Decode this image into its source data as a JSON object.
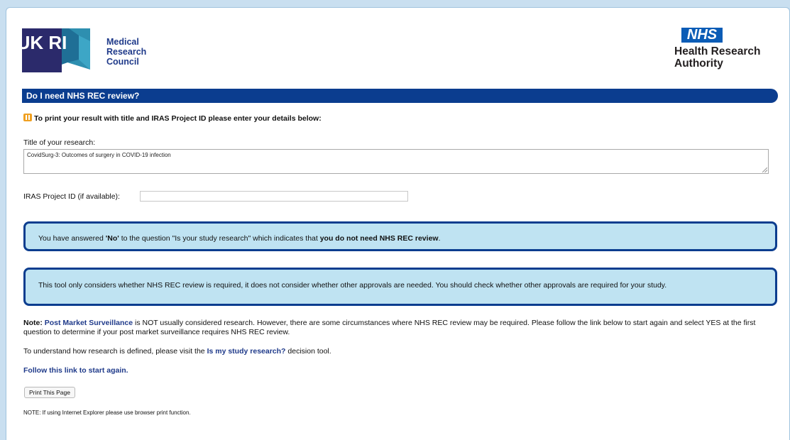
{
  "header": {
    "ukri_logo_text": "UK RI",
    "funder_lines": [
      "Medical",
      "Research",
      "Council"
    ],
    "nhs_logo_text": "NHS",
    "hra_lines": [
      "Health Research",
      "Authority"
    ]
  },
  "page_title": "Do I need NHS REC review?",
  "info_prompt": "To print your result with title and IRAS Project ID please enter your details below:",
  "form": {
    "title_label": "Title of your research:",
    "title_value": "CovidSurg-3: Outcomes of surgery in COVID-19 infection",
    "iras_label": "IRAS Project ID (if available):",
    "iras_value": ""
  },
  "result": {
    "prefix": "You have answered ",
    "answer": "'No'",
    "middle": " to the question \"Is your study research\" which indicates that ",
    "conclusion": "you do not need NHS REC review",
    "suffix": "."
  },
  "disclaimer": "This tool only considers whether NHS REC review is required, it does not consider whether other approvals are needed. You should check whether other approvals are required for your study.",
  "note": {
    "label": "Note:",
    "link": "Post Market Surveillance",
    "text": " is NOT usually considered research. However, there are some circumstances where NHS REC review may be required. Please follow the link below to start again and select YES at the first question to determine if your post market surveillance requires NHS REC review."
  },
  "define": {
    "prefix": "To understand how research is defined, please visit the ",
    "link": "Is my study research?",
    "suffix": " decision tool."
  },
  "restart_link": "Follow this link to start again.",
  "print_button": "Print This Page",
  "ie_note": "NOTE: If using Internet Explorer please use browser print function.",
  "colors": {
    "title_bar": "#0b3d8f",
    "callout_bg": "#bfe3f2",
    "link": "#1f3a8a",
    "nhs_blue": "#0b5cb6",
    "info_icon": "#f0a020"
  }
}
